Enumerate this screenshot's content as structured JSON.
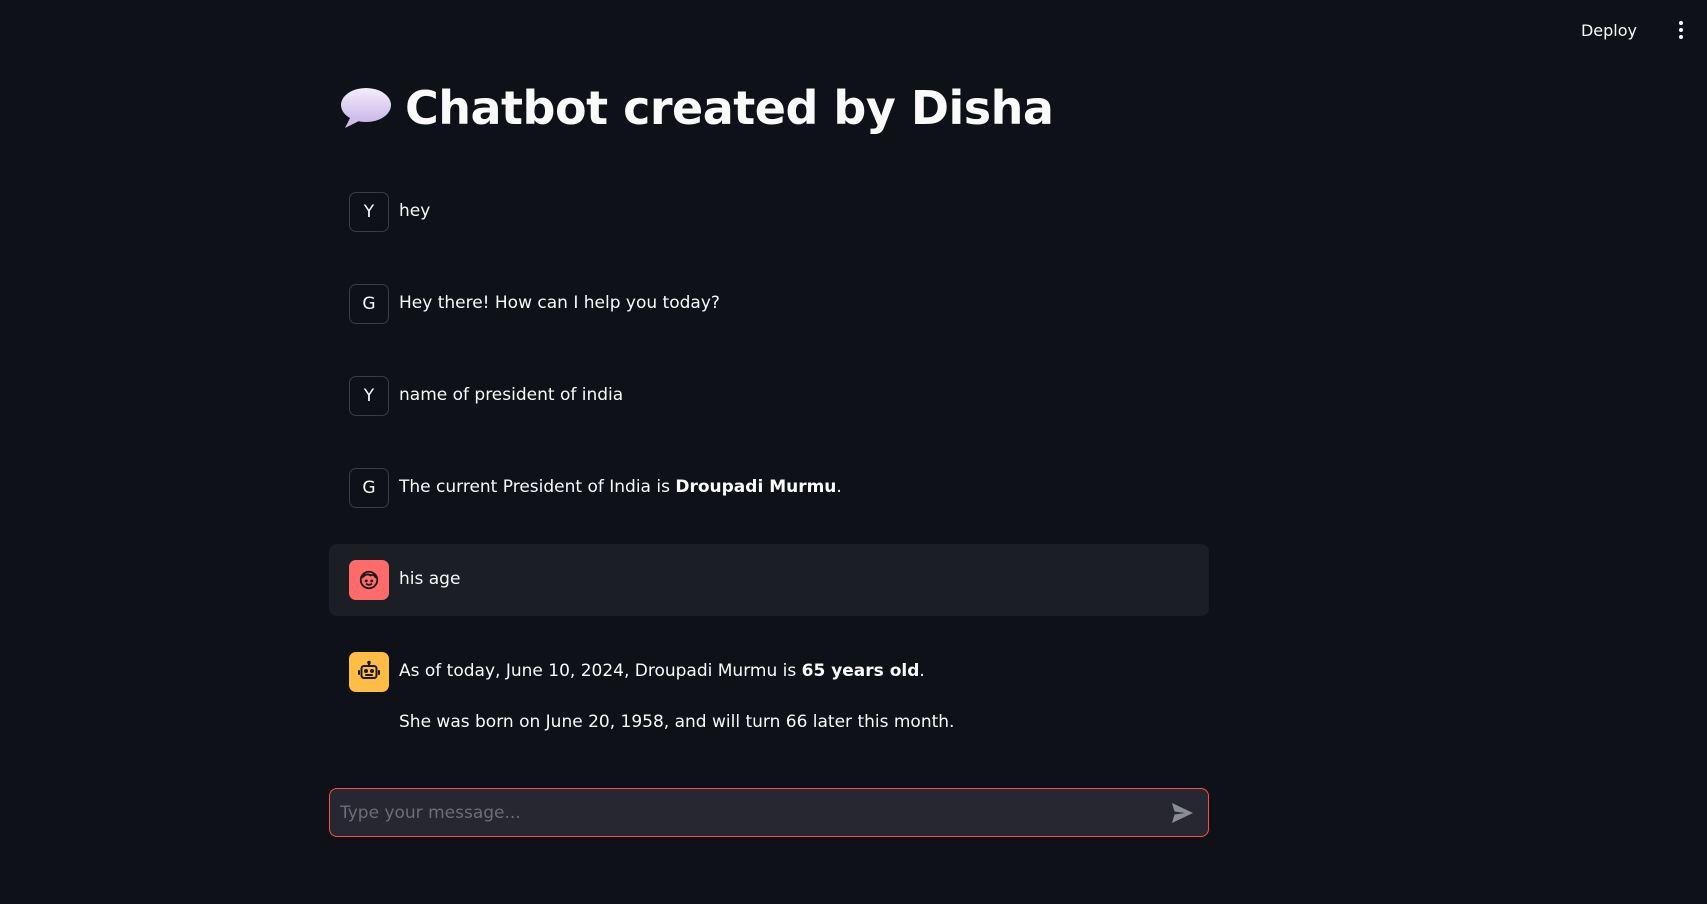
{
  "topbar": {
    "deploy_label": "Deploy"
  },
  "header": {
    "title": "Chatbot created by Disha",
    "icon": "speech-balloon-icon"
  },
  "messages": [
    {
      "role": "user",
      "avatar_letter": "Y",
      "text": "hey"
    },
    {
      "role": "assistant",
      "avatar_letter": "G",
      "text": "Hey there! How can I help you today?"
    },
    {
      "role": "user",
      "avatar_letter": "Y",
      "text": "name of president of india"
    },
    {
      "role": "assistant",
      "avatar_letter": "G",
      "text_before": "The current President of India is ",
      "text_bold": "Droupadi Murmu",
      "text_after": "."
    },
    {
      "role": "user",
      "avatar_icon": "user-face-icon",
      "text": "his age"
    },
    {
      "role": "assistant",
      "avatar_icon": "robot-icon",
      "line1_before": "As of today, June 10, 2024, Droupadi Murmu is ",
      "line1_bold": "65 years old",
      "line1_after": ".",
      "line2": "She was born on June 20, 1958, and will turn 66 later this month."
    }
  ],
  "chat_input": {
    "placeholder": "Type your message...",
    "value": ""
  },
  "colors": {
    "background": "#0e1117",
    "highlight": "#1c1e26",
    "user_avatar": "#ff6b6b",
    "bot_avatar": "#ffbd45",
    "input_border": "#ff4b4b"
  }
}
